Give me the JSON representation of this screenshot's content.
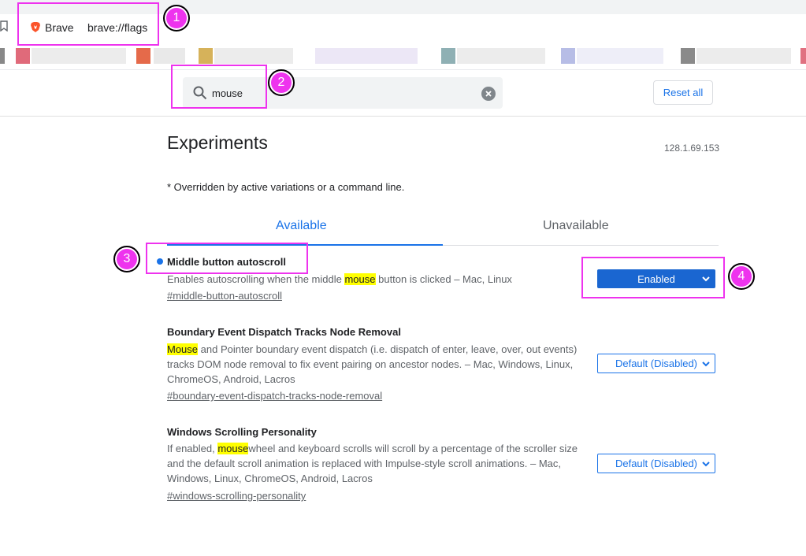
{
  "browser": {
    "brand": "Brave",
    "url": "brave://flags"
  },
  "search": {
    "value": "mouse"
  },
  "toolbar": {
    "reset_label": "Reset all"
  },
  "page": {
    "title": "Experiments",
    "version": "128.1.69.153",
    "note": "* Overridden by active variations or a command line."
  },
  "tabs": [
    {
      "label": "Available",
      "active": true
    },
    {
      "label": "Unavailable",
      "active": false
    }
  ],
  "experiments": [
    {
      "title": "Middle button autoscroll",
      "desc_parts": [
        "Enables autoscrolling when the middle ",
        "mouse",
        " button is clicked – Mac, Linux"
      ],
      "link": "#middle-button-autoscroll",
      "selected": "Enabled"
    },
    {
      "title": "Boundary Event Dispatch Tracks Node Removal",
      "desc_parts": [
        "",
        "Mouse",
        " and Pointer boundary event dispatch (i.e. dispatch of enter, leave, over, out events) tracks DOM node removal to fix event pairing on ancestor nodes. – Mac, Windows, Linux, ChromeOS, Android, Lacros"
      ],
      "link": "#boundary-event-dispatch-tracks-node-removal",
      "selected": "Default (Disabled)"
    },
    {
      "title": "Windows Scrolling Personality",
      "desc_parts": [
        "If enabled, ",
        "mouse",
        "wheel and keyboard scrolls will scroll by a percentage of the scroller size and the default scroll animation is replaced with Impulse-style scroll animations. – Mac, Windows, Linux, ChromeOS, Android, Lacros"
      ],
      "link": "#windows-scrolling-personality",
      "selected": "Default (Disabled)"
    }
  ],
  "annotations": [
    "1",
    "2",
    "3",
    "4"
  ],
  "colors": {
    "accent": "#1a73e8",
    "highlight": "#ffff00",
    "annotation": "#ee33ee"
  },
  "icons": [
    "bookmark-icon",
    "brave-logo-icon",
    "search-icon",
    "clear-icon",
    "chevron-down-icon"
  ]
}
